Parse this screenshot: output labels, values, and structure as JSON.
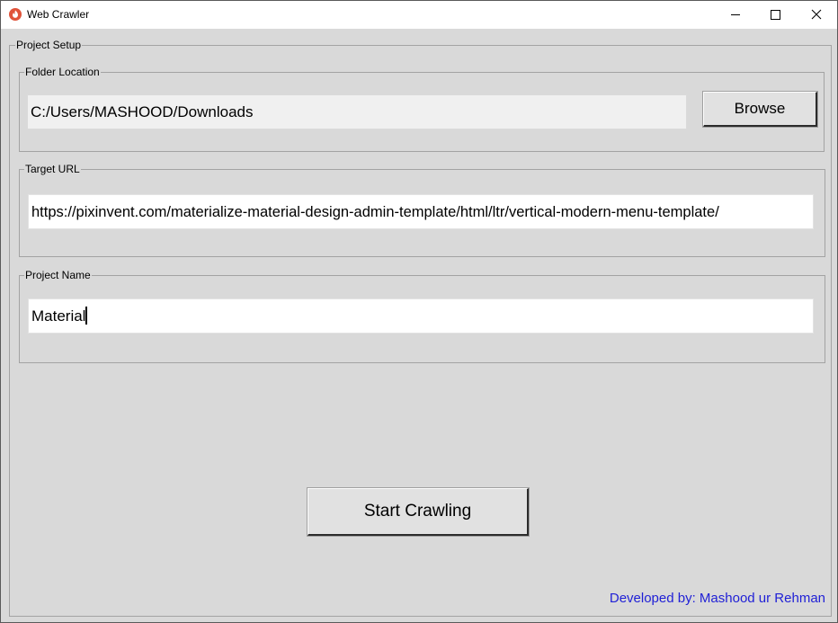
{
  "window": {
    "title": "Web Crawler",
    "icon": "flame-app-icon",
    "controls": [
      "minimize-icon",
      "maximize-icon",
      "close-icon"
    ]
  },
  "project_setup": {
    "label": "Project Setup",
    "folder_location": {
      "label": "Folder Location",
      "value": "C:/Users/MASHOOD/Downloads",
      "browse_label": "Browse"
    },
    "target_url": {
      "label": "Target URL",
      "value": "https://pixinvent.com/materialize-material-design-admin-template/html/ltr/vertical-modern-menu-template/"
    },
    "project_name": {
      "label": "Project Name",
      "value": "Material"
    },
    "start_label": "Start Crawling"
  },
  "footer": {
    "credit": "Developed by: Mashood ur Rehman"
  },
  "colors": {
    "window_bg": "#d9d9d9",
    "credit_text": "#1f1fd6",
    "app_icon": "#e0533a"
  }
}
